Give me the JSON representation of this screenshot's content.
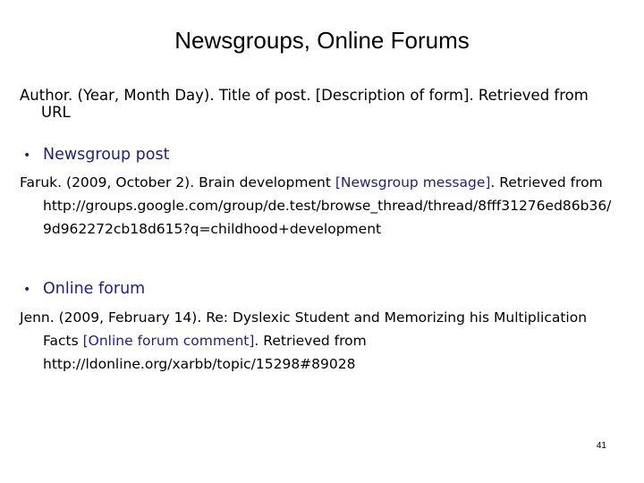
{
  "title": "Newsgroups, Online Forums",
  "format": {
    "line1": "Author. (Year, Month Day). Title of post. [Description of form]. Retrieved from",
    "line2": "URL"
  },
  "sections": [
    {
      "bullet": "Newsgroup post",
      "ref": {
        "line1_pre": "Faruk. (2009, October 2). Brain development ",
        "line1_desc": "[Newsgroup message]",
        "line1_post": ". Retrieved from",
        "line2": "http://groups.google.com/group/de.test/browse_thread/thread/8fff31276ed86b36/",
        "line3": "9d962272cb18d615?q=childhood+development"
      }
    },
    {
      "bullet": "Online forum",
      "ref": {
        "line1": "Jenn. (2009, February 14). Re: Dyslexic Student and Memorizing his Multiplication",
        "line2_pre": "Facts ",
        "line2_desc": "[Online forum comment]",
        "line2_post": ". Retrieved from",
        "line3": "http://ldonline.org/xarbb/topic/15298#89028"
      }
    }
  ],
  "page_number": "41",
  "colors": {
    "accent": "#1f1f8a",
    "text": "#000000",
    "background": "#ffffff"
  }
}
